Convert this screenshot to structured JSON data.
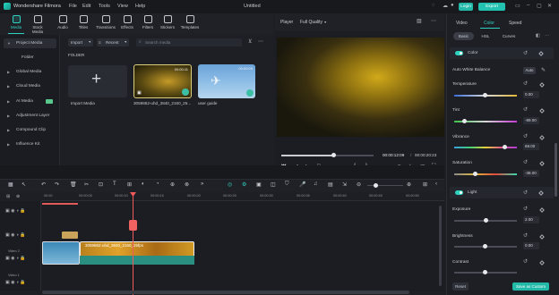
{
  "app": {
    "name": "Wondershare Filmora",
    "project_title": "Untitled"
  },
  "menu": [
    "File",
    "Edit",
    "Tools",
    "View",
    "Help"
  ],
  "titlebar": {
    "login_label": "Login",
    "export_label": "Export"
  },
  "toolbar": {
    "tools": [
      {
        "label": "Media",
        "active": true
      },
      {
        "label": "Stock Media",
        "active": false
      },
      {
        "label": "Audio",
        "active": false
      },
      {
        "label": "Titles",
        "active": false
      },
      {
        "label": "Transitions",
        "active": false
      },
      {
        "label": "Effects",
        "active": false
      },
      {
        "label": "Filters",
        "active": false
      },
      {
        "label": "Stickers",
        "active": false
      },
      {
        "label": "Templates",
        "active": false
      }
    ]
  },
  "sidebar": {
    "items": [
      {
        "label": "Project Media"
      },
      {
        "label": "Folder"
      },
      {
        "label": "Global Media"
      },
      {
        "label": "Cloud Media"
      },
      {
        "label": "AI Media"
      },
      {
        "label": "Adjustment Layer"
      },
      {
        "label": "Compound Clip"
      },
      {
        "label": "Influence Kit"
      }
    ]
  },
  "media": {
    "import_label": "Import",
    "sort_label": "Recent",
    "search_placeholder": "Search media",
    "folder_label": "FOLDER",
    "import_tile_label": "Import Media",
    "items": [
      {
        "name": "3059862-uhd_3840_2160_25...",
        "duration": "00:00:11"
      },
      {
        "name": "user guide",
        "duration": "00:00:05"
      }
    ]
  },
  "player": {
    "label": "Player",
    "quality": "Full Quality",
    "current_time": "00:00:12:09",
    "total_time": "00:00:20:23"
  },
  "right_panel": {
    "tabs": [
      "Video",
      "Color",
      "Speed"
    ],
    "active_tab": "Color",
    "subtabs": [
      "Basic",
      "HSL",
      "Curves"
    ],
    "color_section": "Color",
    "auto_white_balance": "Auto White Balance",
    "auto_label": "Auto",
    "params": [
      {
        "label": "Temperature",
        "value": "0.00"
      },
      {
        "label": "Tint",
        "value": "-89.00"
      },
      {
        "label": "Vibrance",
        "value": "69.00"
      },
      {
        "label": "Saturation",
        "value": "-38.00"
      }
    ],
    "light_section": "Light",
    "light_params": [
      {
        "label": "Exposure",
        "value": "2.00"
      },
      {
        "label": "Brightness",
        "value": "0.00"
      },
      {
        "label": "Contrast",
        "value": ""
      }
    ],
    "reset_label": "Reset",
    "save_label": "Save as Custom"
  },
  "timeline": {
    "ruler": [
      "00:00",
      "00:00:05",
      "00:00:10",
      "00:00:15",
      "00:00:20",
      "00:00:25",
      "00:00:30",
      "00:00:35",
      "00:00:40",
      "00:00:45",
      "00:00:50"
    ],
    "tracks": [
      "Video 2",
      "Video 1"
    ],
    "clip_name": "3059862-uhd_3840_2160_25fps"
  },
  "colors": {
    "accent": "#2fd2c1",
    "playhead": "#f05a5a"
  }
}
